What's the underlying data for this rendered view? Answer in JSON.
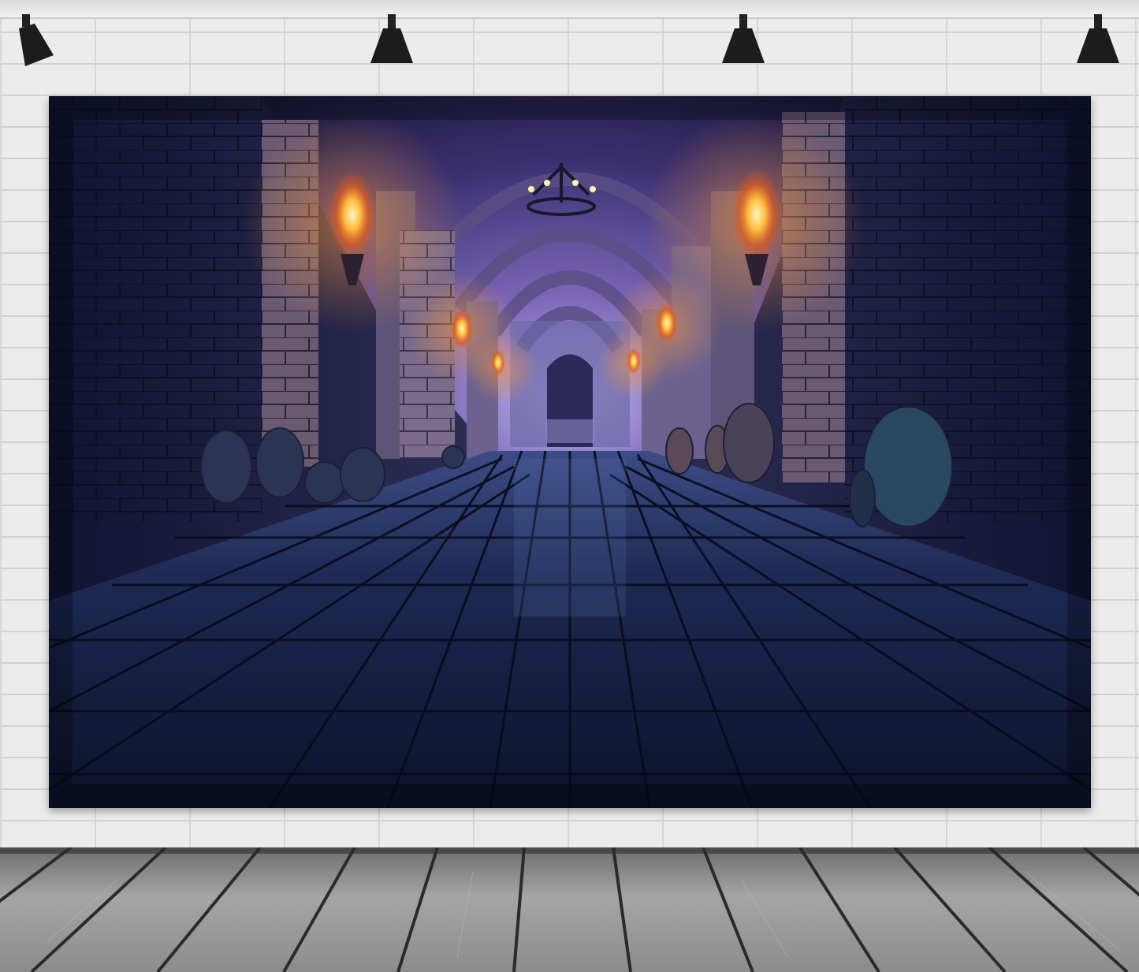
{
  "scene": {
    "subject": "",
    "colors": {
      "wall": "#ececec",
      "floor": "#8a8a8a",
      "corridor_dark": "#141a33",
      "torch_fire": "#ffb13b",
      "haze": "#8a6fc2"
    }
  }
}
